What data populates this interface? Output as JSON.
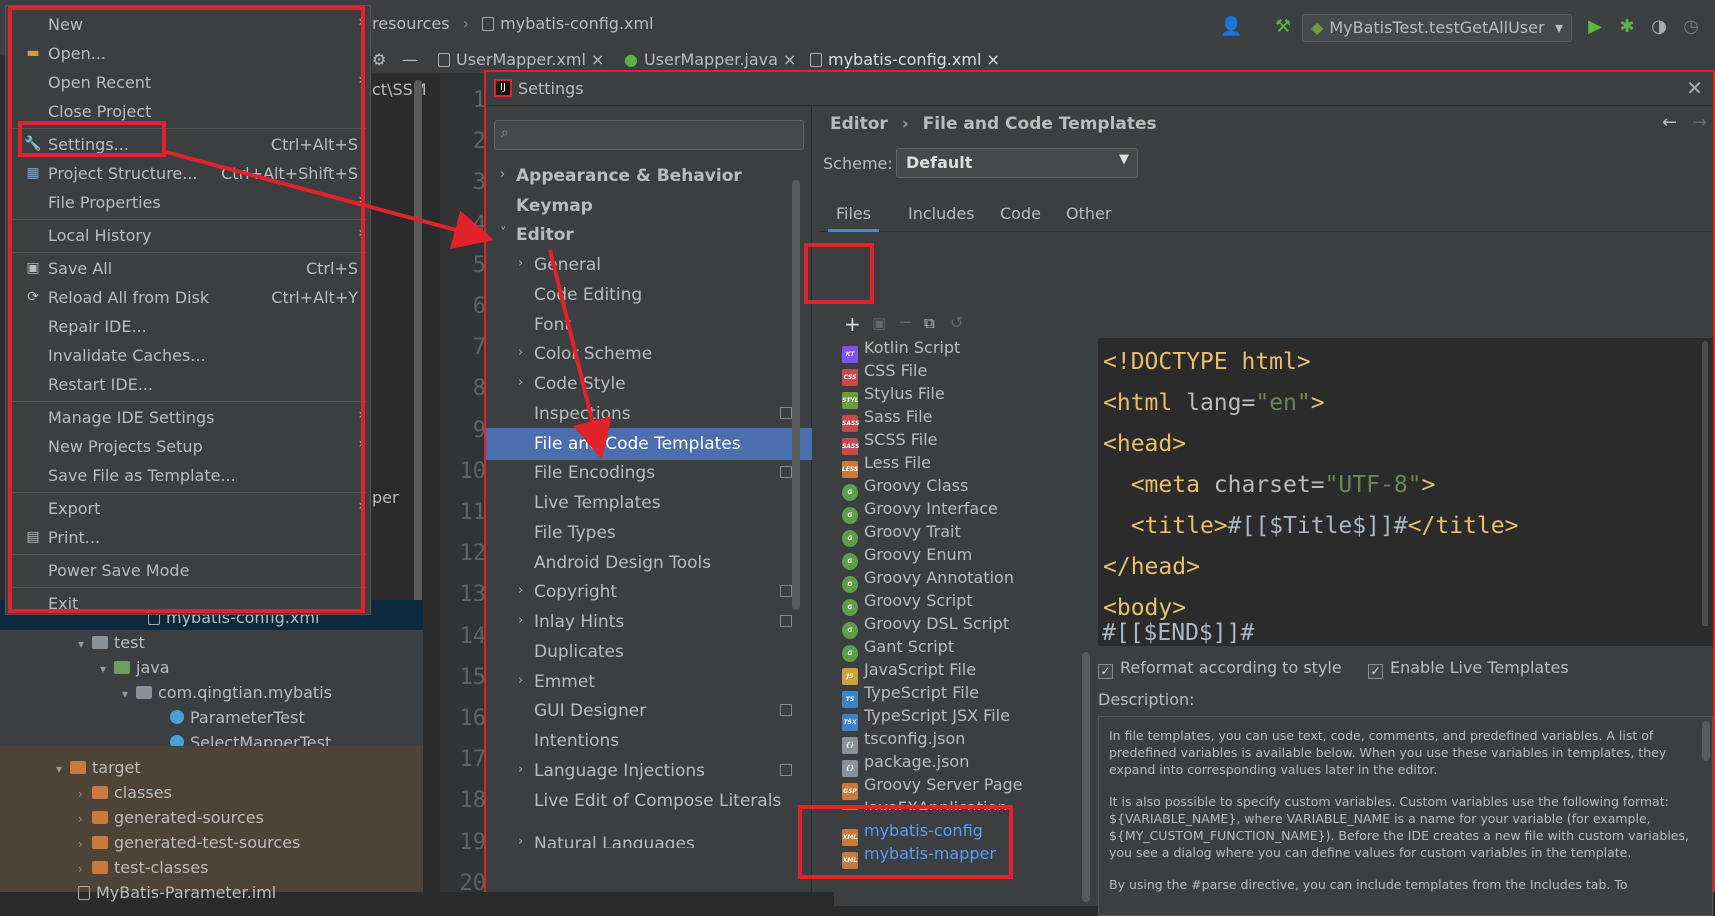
{
  "breadcrumb": {
    "path": "resources",
    "file": "mybatis-config.xml"
  },
  "run_config": "MyBatisTest.testGetAllUser",
  "editor_tabs": [
    "UserMapper.xml",
    "UserMapper.java",
    "mybatis-config.xml"
  ],
  "line_numbers": [
    "1",
    "2",
    "3",
    "4",
    "5",
    "6",
    "7",
    "8",
    "9",
    "10",
    "11",
    "12",
    "13",
    "14",
    "15",
    "16",
    "17",
    "18",
    "19",
    "20"
  ],
  "background_fragments": {
    "path": "ct\\SSM",
    "per": "per"
  },
  "project_tree": [
    {
      "label": "mybatis-config.xml",
      "icon": "xml"
    },
    {
      "label": "test",
      "icon": "folder"
    },
    {
      "label": "java",
      "icon": "folder-green"
    },
    {
      "label": "com.qingtian.mybatis",
      "icon": "folder"
    },
    {
      "label": "ParameterTest",
      "icon": "class"
    },
    {
      "label": "SelectMapperTest",
      "icon": "class"
    },
    {
      "label": "target",
      "icon": "folder-orange"
    },
    {
      "label": "classes",
      "icon": "folder-orange"
    },
    {
      "label": "generated-sources",
      "icon": "folder-orange"
    },
    {
      "label": "generated-test-sources",
      "icon": "folder-orange"
    },
    {
      "label": "test-classes",
      "icon": "folder-orange"
    },
    {
      "label": "MyBatis-Parameter.iml",
      "icon": "file"
    }
  ],
  "file_menu": {
    "items": [
      {
        "label": "New",
        "shortcut": "",
        "submenu": true
      },
      {
        "label": "Open...",
        "shortcut": "",
        "submenu": false
      },
      {
        "label": "Open Recent",
        "shortcut": "",
        "submenu": true
      },
      {
        "label": "Close Project",
        "shortcut": "",
        "submenu": false
      },
      {
        "label": "Settings...",
        "shortcut": "Ctrl+Alt+S",
        "submenu": false
      },
      {
        "label": "Project Structure...",
        "shortcut": "Ctrl+Alt+Shift+S",
        "submenu": false
      },
      {
        "label": "File Properties",
        "shortcut": "",
        "submenu": true
      },
      {
        "label": "Local History",
        "shortcut": "",
        "submenu": true
      },
      {
        "label": "Save All",
        "shortcut": "Ctrl+S",
        "submenu": false
      },
      {
        "label": "Reload All from Disk",
        "shortcut": "Ctrl+Alt+Y",
        "submenu": false
      },
      {
        "label": "Repair IDE...",
        "shortcut": "",
        "submenu": false
      },
      {
        "label": "Invalidate Caches...",
        "shortcut": "",
        "submenu": false
      },
      {
        "label": "Restart IDE...",
        "shortcut": "",
        "submenu": false
      },
      {
        "label": "Manage IDE Settings",
        "shortcut": "",
        "submenu": true
      },
      {
        "label": "New Projects Setup",
        "shortcut": "",
        "submenu": true
      },
      {
        "label": "Save File as Template...",
        "shortcut": "",
        "submenu": false
      },
      {
        "label": "Export",
        "shortcut": "",
        "submenu": true
      },
      {
        "label": "Print...",
        "shortcut": "",
        "submenu": false
      },
      {
        "label": "Power Save Mode",
        "shortcut": "",
        "submenu": false
      },
      {
        "label": "Exit",
        "shortcut": "",
        "submenu": false
      }
    ]
  },
  "settings": {
    "title": "Settings",
    "search_placeholder": "",
    "nav": [
      {
        "label": "Appearance & Behavior",
        "expand": "collapsed",
        "level": 0,
        "bold": true
      },
      {
        "label": "Keymap",
        "expand": "none",
        "level": 0,
        "bold": true
      },
      {
        "label": "Editor",
        "expand": "expanded",
        "level": 0,
        "bold": true
      },
      {
        "label": "General",
        "expand": "collapsed",
        "level": 1
      },
      {
        "label": "Code Editing",
        "expand": "none",
        "level": 1
      },
      {
        "label": "Font",
        "expand": "none",
        "level": 1
      },
      {
        "label": "Color Scheme",
        "expand": "collapsed",
        "level": 1
      },
      {
        "label": "Code Style",
        "expand": "collapsed",
        "level": 1
      },
      {
        "label": "Inspections",
        "expand": "none",
        "level": 1,
        "project": true
      },
      {
        "label": "File and Code Templates",
        "expand": "none",
        "level": 1,
        "selected": true
      },
      {
        "label": "File Encodings",
        "expand": "none",
        "level": 1,
        "project": true
      },
      {
        "label": "Live Templates",
        "expand": "none",
        "level": 1
      },
      {
        "label": "File Types",
        "expand": "none",
        "level": 1
      },
      {
        "label": "Android Design Tools",
        "expand": "none",
        "level": 1
      },
      {
        "label": "Copyright",
        "expand": "collapsed",
        "level": 1,
        "project": true
      },
      {
        "label": "Inlay Hints",
        "expand": "collapsed",
        "level": 1,
        "project": true
      },
      {
        "label": "Duplicates",
        "expand": "none",
        "level": 1
      },
      {
        "label": "Emmet",
        "expand": "collapsed",
        "level": 1
      },
      {
        "label": "GUI Designer",
        "expand": "none",
        "level": 1,
        "project": true
      },
      {
        "label": "Intentions",
        "expand": "none",
        "level": 1
      },
      {
        "label": "Language Injections",
        "expand": "collapsed",
        "level": 1,
        "project": true
      },
      {
        "label": "Live Edit of Compose Literals",
        "expand": "none",
        "level": 1
      },
      {
        "label": "Natural Languages",
        "expand": "collapsed",
        "level": 1
      }
    ],
    "breadcrumb": {
      "parent": "Editor",
      "current": "File and Code Templates"
    },
    "scheme_label": "Scheme:",
    "scheme_value": "Default",
    "tabs": [
      "Files",
      "Includes",
      "Code",
      "Other"
    ],
    "templates": [
      {
        "label": "Kotlin Script",
        "color": "#7f52ff",
        "tag": "KT"
      },
      {
        "label": "CSS File",
        "color": "#c54b4b",
        "tag": "CSS"
      },
      {
        "label": "Stylus File",
        "color": "#6a9c3d",
        "tag": "STYL"
      },
      {
        "label": "Sass File",
        "color": "#c54b4b",
        "tag": "SASS"
      },
      {
        "label": "SCSS File",
        "color": "#c54b4b",
        "tag": "SASS"
      },
      {
        "label": "Less File",
        "color": "#c97a3c",
        "tag": "LESS"
      },
      {
        "label": "Groovy Class",
        "color": "#5e9e4a",
        "tag": "G"
      },
      {
        "label": "Groovy Interface",
        "color": "#5e9e4a",
        "tag": "G"
      },
      {
        "label": "Groovy Trait",
        "color": "#5e9e4a",
        "tag": "G"
      },
      {
        "label": "Groovy Enum",
        "color": "#5e9e4a",
        "tag": "G"
      },
      {
        "label": "Groovy Annotation",
        "color": "#5e9e4a",
        "tag": "G"
      },
      {
        "label": "Groovy Script",
        "color": "#5e9e4a",
        "tag": "G"
      },
      {
        "label": "Groovy DSL Script",
        "color": "#5e9e4a",
        "tag": "G"
      },
      {
        "label": "Gant Script",
        "color": "#5e9e4a",
        "tag": "G"
      },
      {
        "label": "JavaScript File",
        "color": "#c9a23c",
        "tag": "JS"
      },
      {
        "label": "TypeScript File",
        "color": "#3c84c9",
        "tag": "TS"
      },
      {
        "label": "TypeScript JSX File",
        "color": "#3c84c9",
        "tag": "TSX"
      },
      {
        "label": "tsconfig.json",
        "color": "#8a9199",
        "tag": "{}"
      },
      {
        "label": "package.json",
        "color": "#8a9199",
        "tag": "{}"
      },
      {
        "label": "Groovy Server Page",
        "color": "#c97a3c",
        "tag": "GSP"
      },
      {
        "label": "JavaFXApplication",
        "color": "#c97a3c",
        "tag": "FX"
      },
      {
        "label": "mybatis-config",
        "color": "#c97a3c",
        "tag": "XML",
        "custom": true
      },
      {
        "label": "mybatis-mapper",
        "color": "#c97a3c",
        "tag": "XML",
        "custom": true
      }
    ],
    "code": [
      {
        "indent": "",
        "tag_open": "<!DOCTYPE html>",
        "rest": ""
      },
      {
        "indent": "",
        "tag_open": "<html ",
        "attr": "lang=",
        "val": "\"en\"",
        "close": ">"
      },
      {
        "indent": "",
        "tag_open": "<head>",
        "rest": ""
      },
      {
        "indent": "  ",
        "tag_open": "<meta ",
        "attr": "charset=",
        "val": "\"UTF-8\"",
        "close": ">"
      },
      {
        "indent": "  ",
        "tag_open": "<title>",
        "text": "#[[$Title$]]#",
        "tag_close": "</title>"
      },
      {
        "indent": "",
        "tag_open": "</head>",
        "rest": ""
      },
      {
        "indent": "",
        "tag_open": "<body>",
        "rest": ""
      },
      {
        "indent": "",
        "text": "#[[$END$]]#"
      }
    ],
    "reformat_label": "Reformat according to style",
    "live_templates_label": "Enable Live Templates",
    "description_label": "Description:",
    "description": [
      "In file templates, you can use text, code, comments, and predefined variables. A list of predefined variables is available below. When you use these variables in templates, they expand into corresponding values later in the editor.",
      "It is also possible to specify custom variables. Custom variables use the following format: ${VARIABLE_NAME}, where VARIABLE_NAME is a name for your variable (for example, ${MY_CUSTOM_FUNCTION_NAME}). Before the IDE creates a new file with custom variables, you see a dialog where you can define values for custom variables in the template.",
      "By using the #parse directive, you can include templates from the Includes tab. To"
    ]
  },
  "colors": {
    "accent": "#4b6eaf",
    "annotation": "#e0222a",
    "custom_template": "#589df6"
  }
}
